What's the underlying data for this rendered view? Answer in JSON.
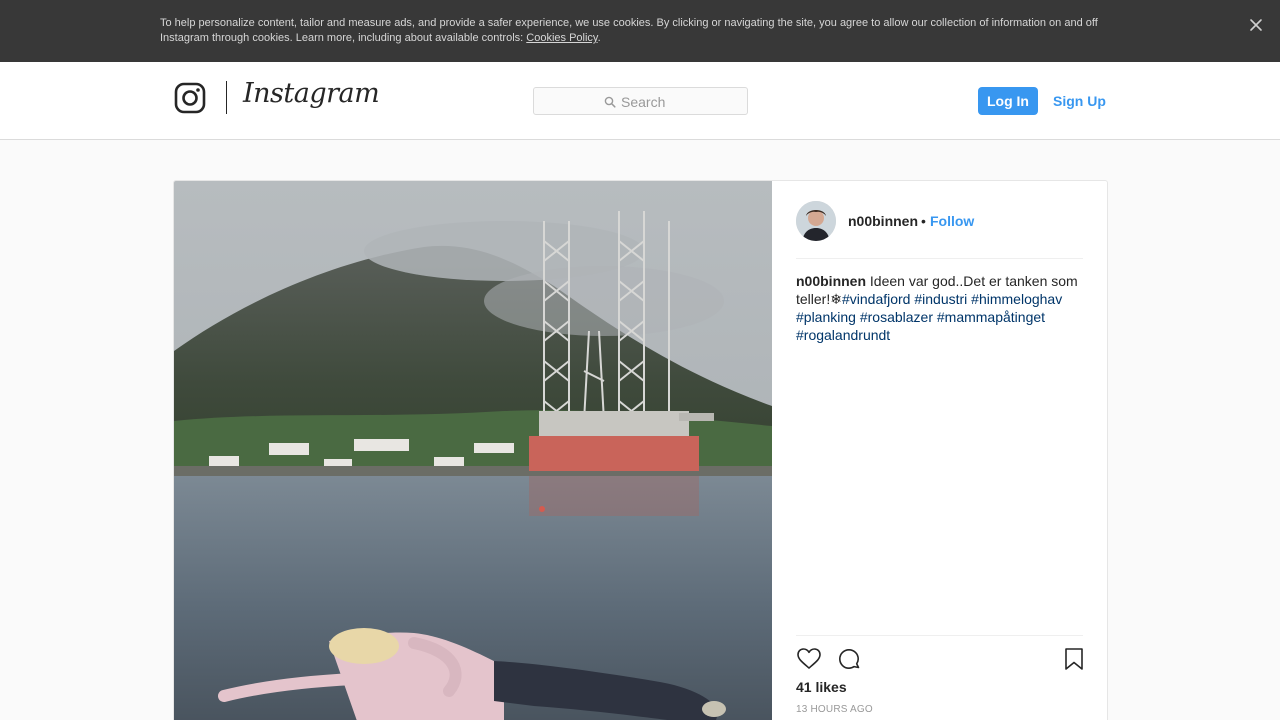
{
  "cookie_banner": {
    "text": "To help personalize content, tailor and measure ads, and provide a safer experience, we use cookies. By clicking or navigating the site, you agree to allow our collection of information on and off Instagram through cookies. Learn more, including about available controls: ",
    "link_text": "Cookies Policy",
    "trailing": ".",
    "close_icon": "close-icon"
  },
  "header": {
    "logo_icon": "instagram-camera-icon",
    "wordmark": "Instagram",
    "search": {
      "placeholder": "Search",
      "icon": "search-icon"
    },
    "login_label": "Log In",
    "signup_label": "Sign Up"
  },
  "post": {
    "username": "n00binnen",
    "dot": "•",
    "follow_label": "Follow",
    "caption": {
      "user": "n00binnen",
      "text": " Ideen var god..Det er tanken som teller!❄",
      "hashtags": [
        "#vindafjord",
        "#industri",
        "#himmeloghav",
        "#planking",
        "#rosablazer",
        "#mammapåtinget",
        "#rogalandrundt"
      ]
    },
    "likes": "41 likes",
    "timestamp": "13 HOURS AGO",
    "icons": {
      "like": "heart-icon",
      "comment": "comment-icon",
      "save": "bookmark-icon"
    }
  },
  "colors": {
    "accent": "#3897f0",
    "banner_bg": "#383838",
    "hashtag": "#003569",
    "page_bg": "#fafafa"
  }
}
